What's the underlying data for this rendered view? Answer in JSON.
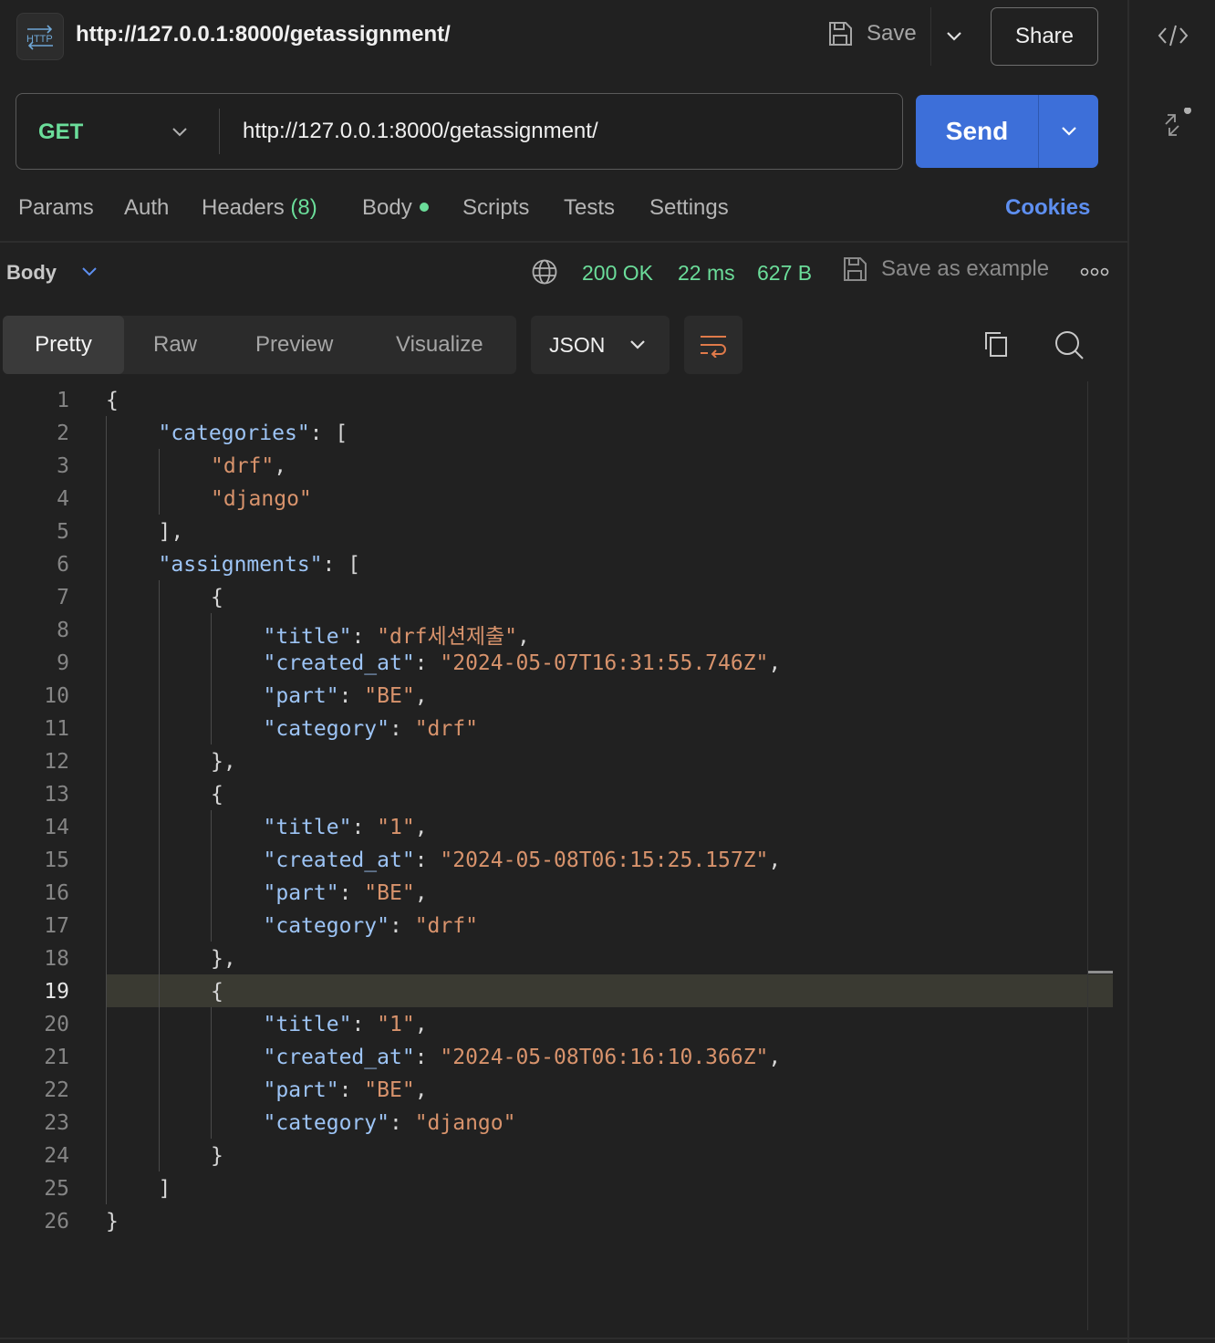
{
  "header": {
    "title": "http://127.0.0.1:8000/getassignment/",
    "save_label": "Save",
    "share_label": "Share"
  },
  "request": {
    "method": "GET",
    "url": "http://127.0.0.1:8000/getassignment/",
    "send_label": "Send"
  },
  "request_tabs": {
    "params": "Params",
    "auth": "Auth",
    "headers": "Headers",
    "headers_count": "(8)",
    "body": "Body",
    "scripts": "Scripts",
    "tests": "Tests",
    "settings": "Settings",
    "cookies": "Cookies"
  },
  "response": {
    "body_label": "Body",
    "status": "200 OK",
    "time": "22 ms",
    "size": "627 B",
    "save_example_label": "Save as example"
  },
  "view_tabs": {
    "pretty": "Pretty",
    "raw": "Raw",
    "preview": "Preview",
    "visualize": "Visualize",
    "format": "JSON"
  },
  "editor": {
    "highlighted_line": 19,
    "lines": [
      {
        "n": "1",
        "indent": 0,
        "parts": [
          [
            "p",
            "{"
          ]
        ]
      },
      {
        "n": "2",
        "indent": 1,
        "parts": [
          [
            "k",
            "\"categories\""
          ],
          [
            "p",
            ": ["
          ]
        ]
      },
      {
        "n": "3",
        "indent": 2,
        "parts": [
          [
            "s",
            "\"drf\""
          ],
          [
            "p",
            ","
          ]
        ]
      },
      {
        "n": "4",
        "indent": 2,
        "parts": [
          [
            "s",
            "\"django\""
          ]
        ]
      },
      {
        "n": "5",
        "indent": 1,
        "parts": [
          [
            "p",
            "],"
          ]
        ]
      },
      {
        "n": "6",
        "indent": 1,
        "parts": [
          [
            "k",
            "\"assignments\""
          ],
          [
            "p",
            ": ["
          ]
        ]
      },
      {
        "n": "7",
        "indent": 2,
        "parts": [
          [
            "p",
            "{"
          ]
        ]
      },
      {
        "n": "8",
        "indent": 3,
        "parts": [
          [
            "k",
            "\"title\""
          ],
          [
            "p",
            ": "
          ],
          [
            "s",
            "\"drf세션제출\""
          ],
          [
            "p",
            ","
          ]
        ]
      },
      {
        "n": "9",
        "indent": 3,
        "parts": [
          [
            "k",
            "\"created_at\""
          ],
          [
            "p",
            ": "
          ],
          [
            "s",
            "\"2024-05-07T16:31:55.746Z\""
          ],
          [
            "p",
            ","
          ]
        ]
      },
      {
        "n": "10",
        "indent": 3,
        "parts": [
          [
            "k",
            "\"part\""
          ],
          [
            "p",
            ": "
          ],
          [
            "s",
            "\"BE\""
          ],
          [
            "p",
            ","
          ]
        ]
      },
      {
        "n": "11",
        "indent": 3,
        "parts": [
          [
            "k",
            "\"category\""
          ],
          [
            "p",
            ": "
          ],
          [
            "s",
            "\"drf\""
          ]
        ]
      },
      {
        "n": "12",
        "indent": 2,
        "parts": [
          [
            "p",
            "},"
          ]
        ]
      },
      {
        "n": "13",
        "indent": 2,
        "parts": [
          [
            "p",
            "{"
          ]
        ]
      },
      {
        "n": "14",
        "indent": 3,
        "parts": [
          [
            "k",
            "\"title\""
          ],
          [
            "p",
            ": "
          ],
          [
            "s",
            "\"1\""
          ],
          [
            "p",
            ","
          ]
        ]
      },
      {
        "n": "15",
        "indent": 3,
        "parts": [
          [
            "k",
            "\"created_at\""
          ],
          [
            "p",
            ": "
          ],
          [
            "s",
            "\"2024-05-08T06:15:25.157Z\""
          ],
          [
            "p",
            ","
          ]
        ]
      },
      {
        "n": "16",
        "indent": 3,
        "parts": [
          [
            "k",
            "\"part\""
          ],
          [
            "p",
            ": "
          ],
          [
            "s",
            "\"BE\""
          ],
          [
            "p",
            ","
          ]
        ]
      },
      {
        "n": "17",
        "indent": 3,
        "parts": [
          [
            "k",
            "\"category\""
          ],
          [
            "p",
            ": "
          ],
          [
            "s",
            "\"drf\""
          ]
        ]
      },
      {
        "n": "18",
        "indent": 2,
        "parts": [
          [
            "p",
            "},"
          ]
        ]
      },
      {
        "n": "19",
        "indent": 2,
        "parts": [
          [
            "p",
            "{"
          ]
        ]
      },
      {
        "n": "20",
        "indent": 3,
        "parts": [
          [
            "k",
            "\"title\""
          ],
          [
            "p",
            ": "
          ],
          [
            "s",
            "\"1\""
          ],
          [
            "p",
            ","
          ]
        ]
      },
      {
        "n": "21",
        "indent": 3,
        "parts": [
          [
            "k",
            "\"created_at\""
          ],
          [
            "p",
            ": "
          ],
          [
            "s",
            "\"2024-05-08T06:16:10.366Z\""
          ],
          [
            "p",
            ","
          ]
        ]
      },
      {
        "n": "22",
        "indent": 3,
        "parts": [
          [
            "k",
            "\"part\""
          ],
          [
            "p",
            ": "
          ],
          [
            "s",
            "\"BE\""
          ],
          [
            "p",
            ","
          ]
        ]
      },
      {
        "n": "23",
        "indent": 3,
        "parts": [
          [
            "k",
            "\"category\""
          ],
          [
            "p",
            ": "
          ],
          [
            "s",
            "\"django\""
          ]
        ]
      },
      {
        "n": "24",
        "indent": 2,
        "parts": [
          [
            "p",
            "}"
          ]
        ]
      },
      {
        "n": "25",
        "indent": 1,
        "parts": [
          [
            "p",
            "]"
          ]
        ]
      },
      {
        "n": "26",
        "indent": 0,
        "parts": [
          [
            "p",
            "}"
          ]
        ]
      }
    ]
  },
  "colors": {
    "accent": "#3d6fd9",
    "method_green": "#6bdd9a",
    "json_key": "#9dc4f5",
    "json_string": "#d8936c",
    "link_blue": "#5e8ff0"
  },
  "icons": [
    "http-icon",
    "save-icon",
    "chevron-down-icon",
    "globe-icon",
    "more-icon",
    "wrap-lines-icon",
    "copy-icon",
    "search-icon",
    "code-icon",
    "collapse-icon"
  ]
}
